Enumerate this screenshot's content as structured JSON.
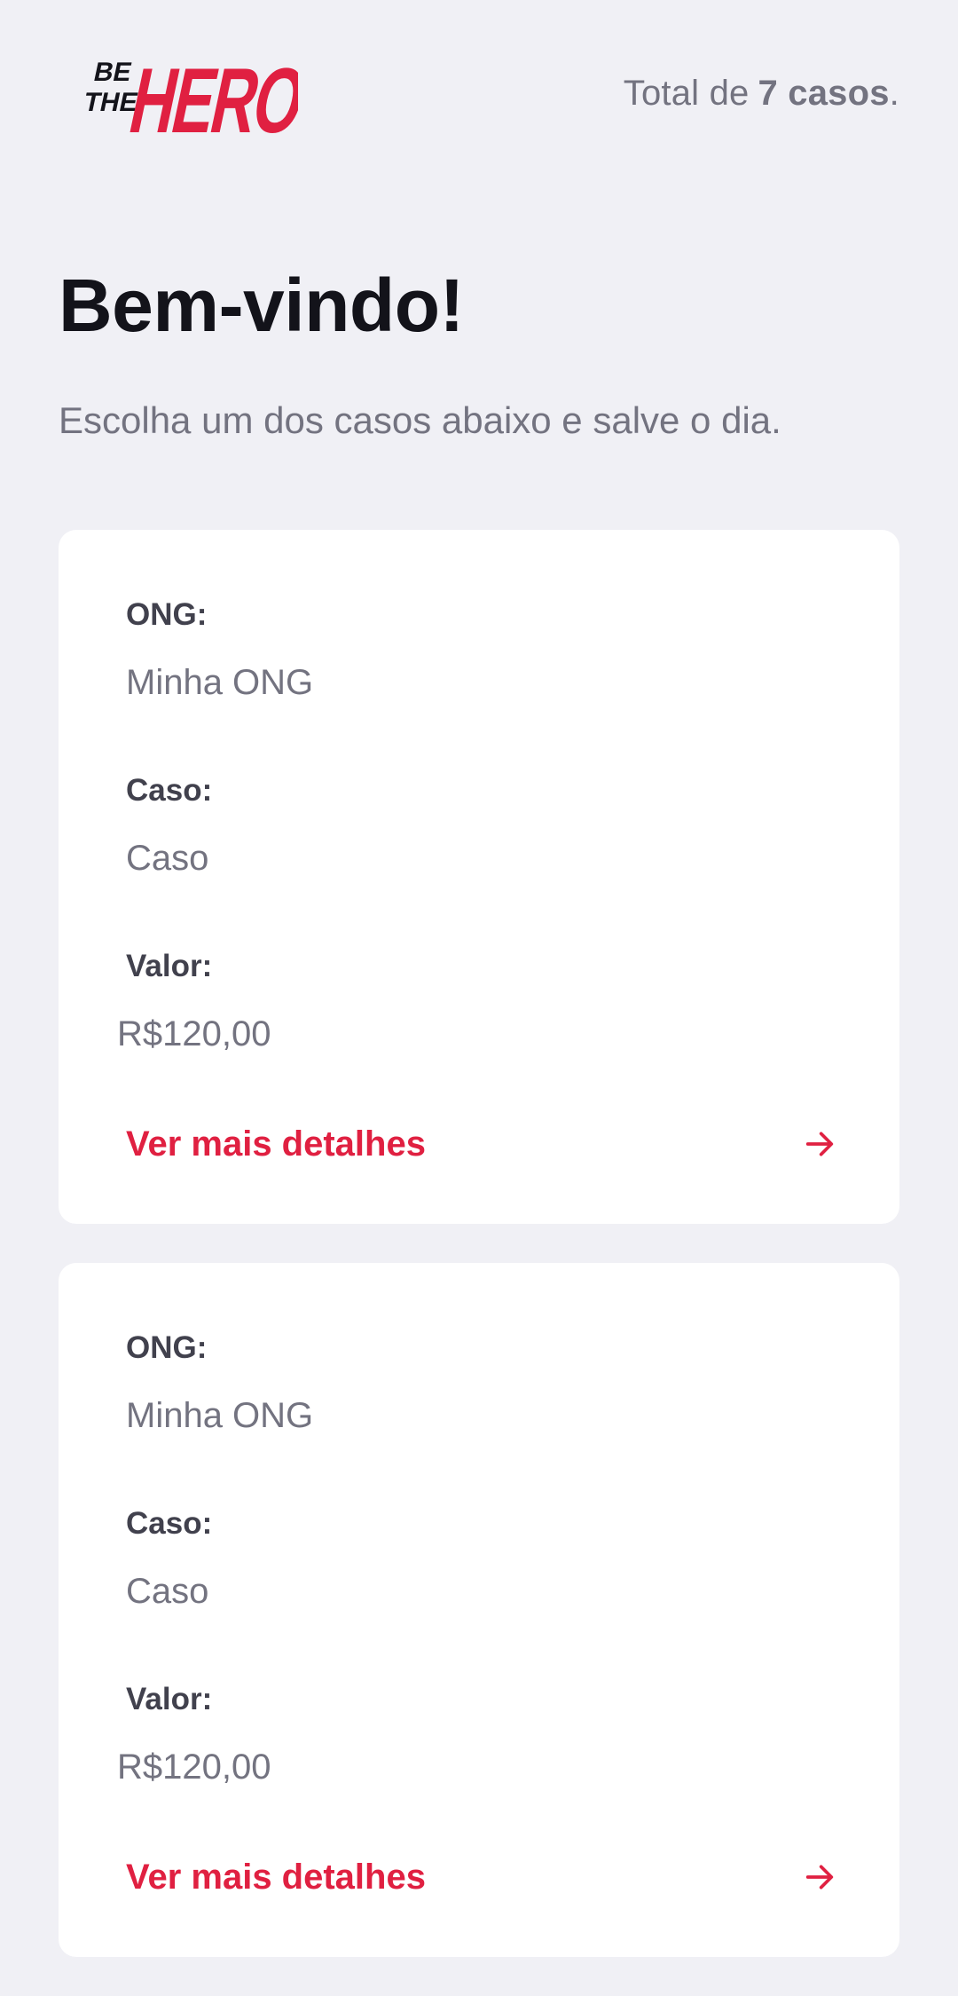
{
  "header": {
    "logo_text_top": "BE",
    "logo_text_mid": "THE",
    "logo_text_main": "HERO",
    "total_prefix": "Total de",
    "total_count": "7 casos",
    "total_suffix": "."
  },
  "welcome": {
    "title": "Bem-vindo!",
    "subtitle": "Escolha um dos casos abaixo e salve o dia."
  },
  "labels": {
    "ong": "ONG:",
    "caso": "Caso:",
    "valor": "Valor:"
  },
  "incidents": [
    {
      "ong": "Minha ONG",
      "caso": "Caso",
      "valor": "R$120,00",
      "details_label": "Ver mais detalhes"
    },
    {
      "ong": "Minha ONG",
      "caso": "Caso",
      "valor": "R$120,00",
      "details_label": "Ver mais detalhes"
    }
  ],
  "colors": {
    "brand_red": "#e02041",
    "background": "#f0f0f5",
    "card": "#ffffff",
    "text_dark": "#13131a",
    "text_gray": "#737380"
  },
  "icons": {
    "details_arrow": "arrow-right-icon"
  }
}
